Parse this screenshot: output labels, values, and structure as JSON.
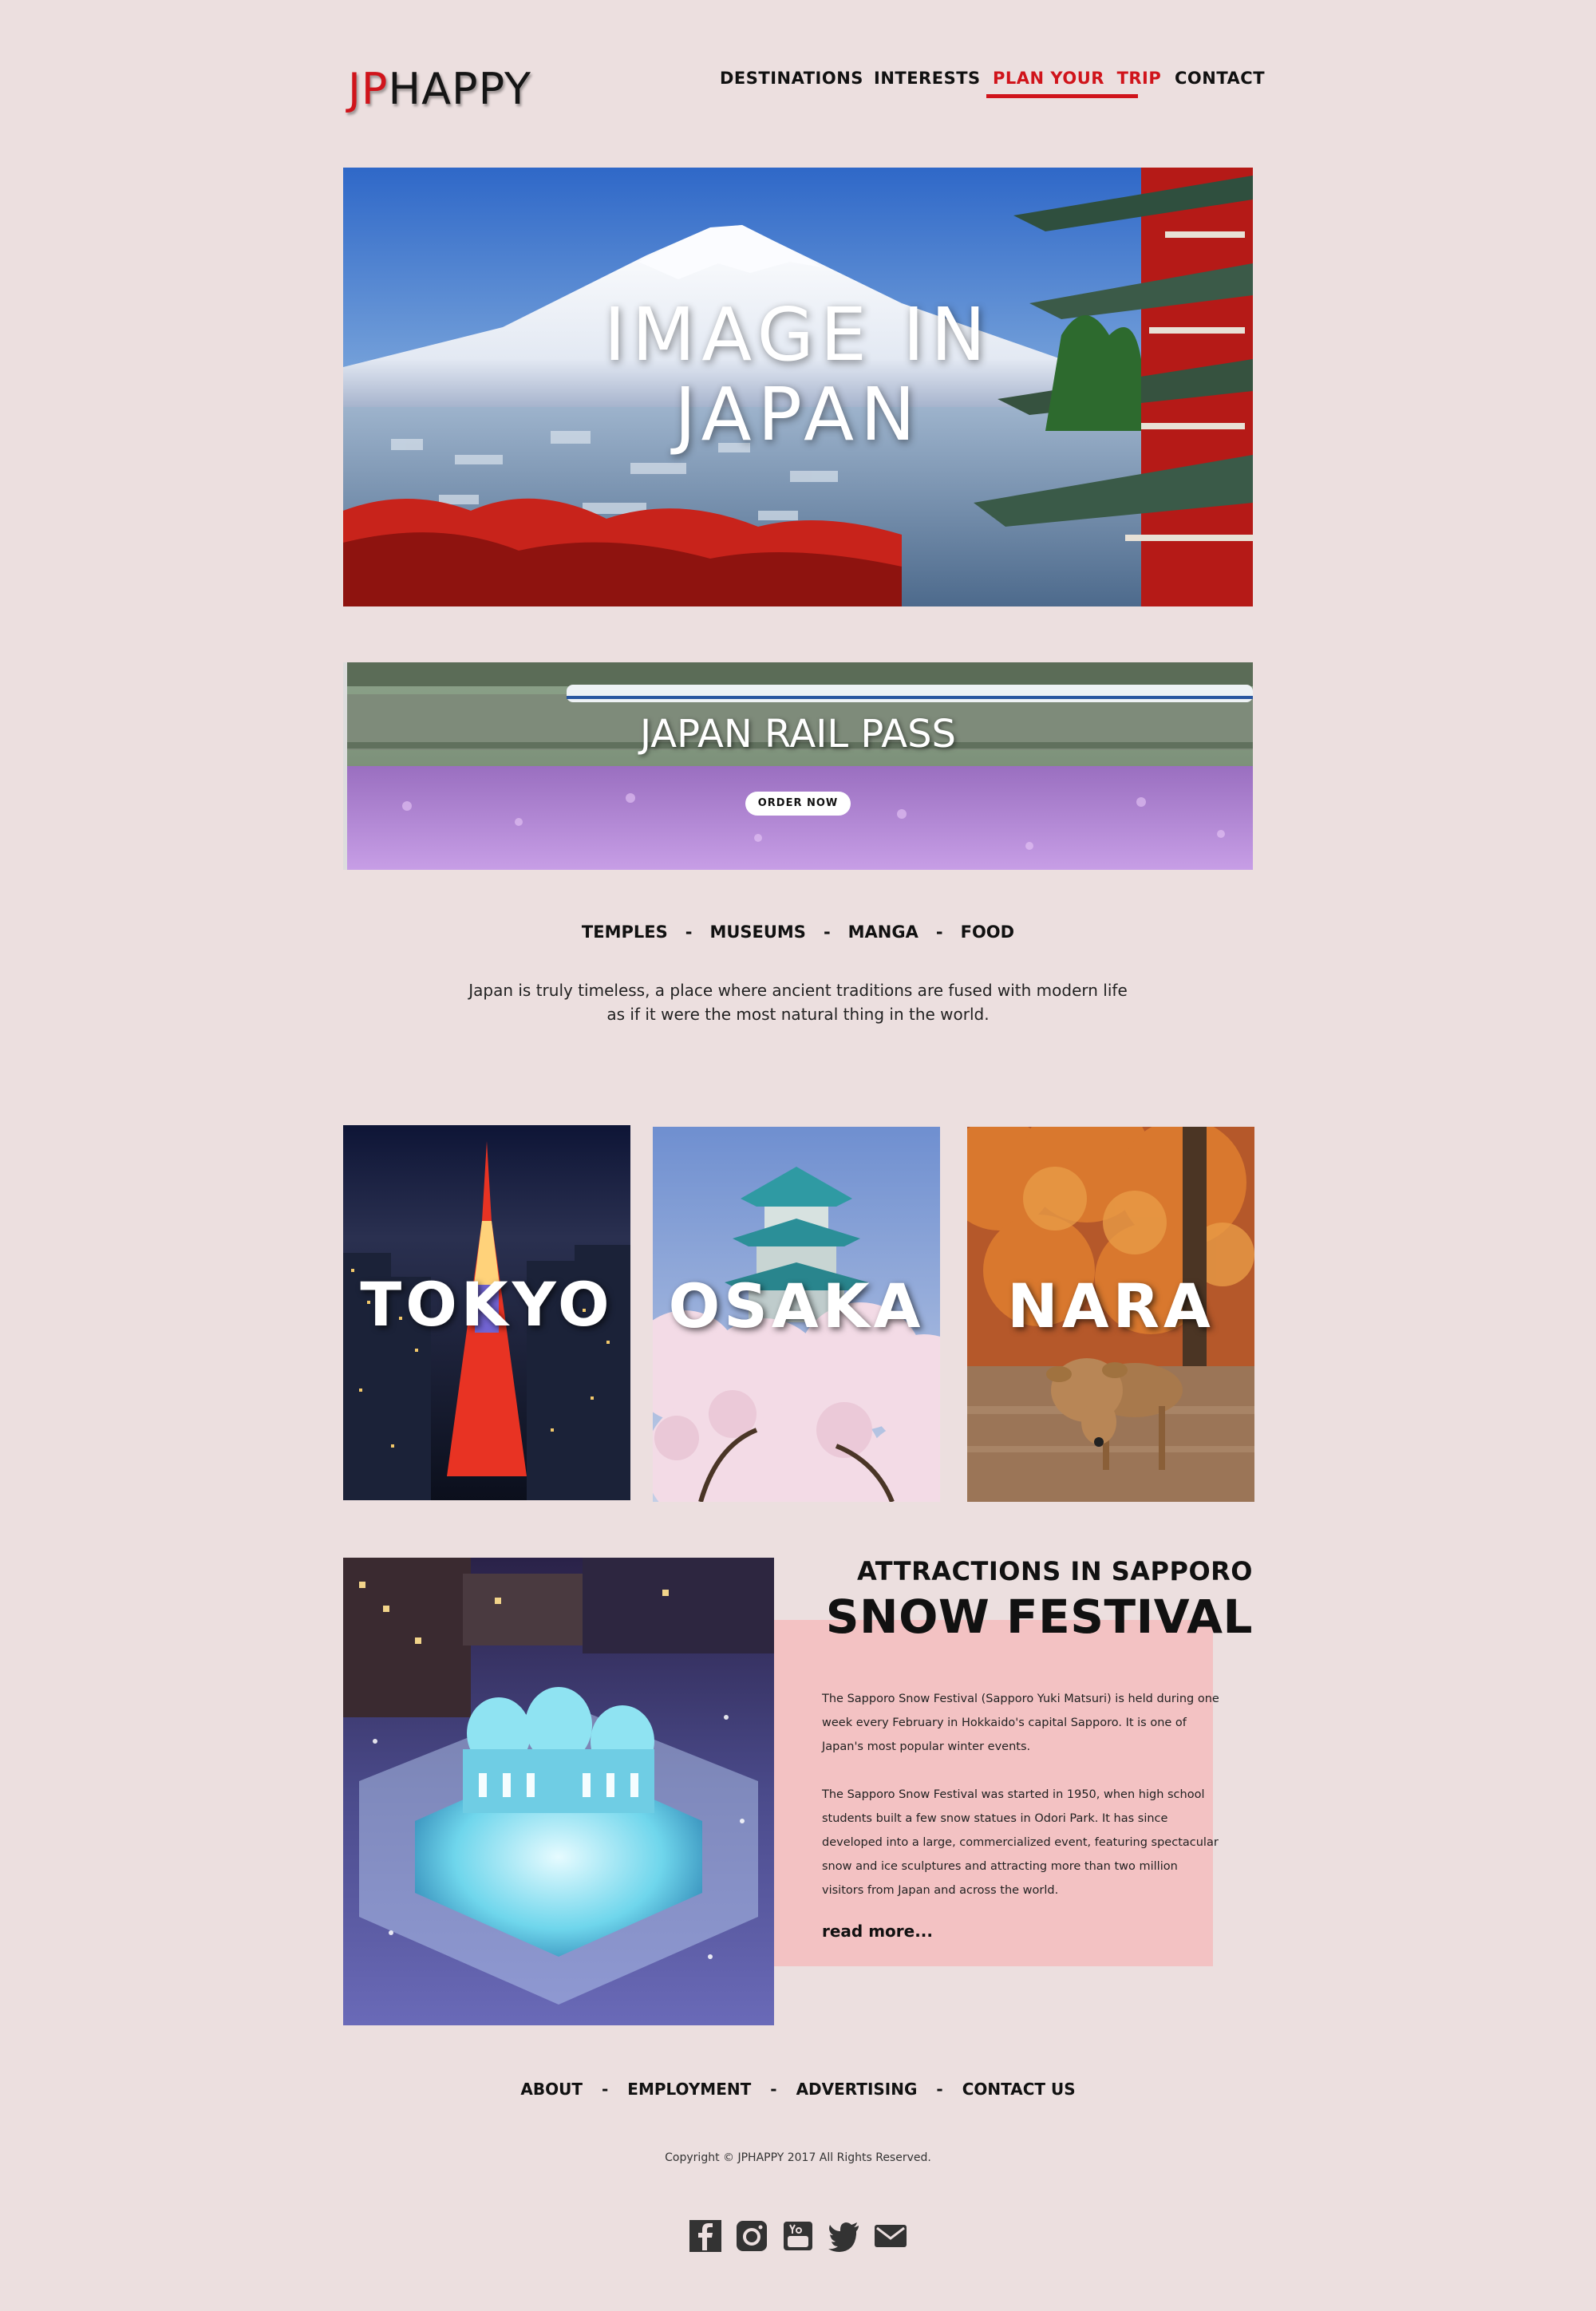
{
  "header": {
    "logo_jp": "JP",
    "logo_happy": "HAPPY",
    "nav": [
      {
        "label": "DESTINATIONS"
      },
      {
        "label": "INTERESTS"
      },
      {
        "label": "PLAN YOUR  TRIP",
        "active": true
      },
      {
        "label": "CONTACT"
      }
    ]
  },
  "hero": {
    "title_line1": "IMAGE IN",
    "title_line2": "JAPAN"
  },
  "rail": {
    "title": "JAPAN RAIL PASS",
    "button": "ORDER NOW"
  },
  "interests": {
    "items": [
      "TEMPLES",
      "MUSEUMS",
      "MANGA",
      "FOOD"
    ],
    "separator": "-"
  },
  "intro": "Japan is truly timeless, a place where ancient traditions are fused with modern life as if it were the most natural thing in the world.",
  "cities": [
    {
      "name": "TOKYO"
    },
    {
      "name": "OSAKA"
    },
    {
      "name": "NARA"
    }
  ],
  "sapporo": {
    "subtitle": "ATTRACTIONS IN SAPPORO",
    "title": "SNOW FESTIVAL",
    "para1": "The Sapporo Snow Festival (Sapporo Yuki Matsuri) is held during one week every February in Hokkaido's capital Sapporo. It is one of Japan's most popular winter events.",
    "para2": "The Sapporo Snow Festival was started in 1950, when high school students built a few snow statues in Odori Park. It has since developed into a large, commercialized event, featuring spectacular snow and ice sculptures and attracting more than two million visitors from Japan and across the world.",
    "read_more": "read more..."
  },
  "footer": {
    "links": [
      "ABOUT",
      "EMPLOYMENT",
      "ADVERTISING",
      "CONTACT US"
    ],
    "separator": "-",
    "copyright": "Copyright © JPHAPPY 2017 All Rights Reserved.",
    "social": [
      "facebook-icon",
      "instagram-icon",
      "youtube-icon",
      "twitter-icon",
      "mail-icon"
    ]
  },
  "colors": {
    "background": "#ecdfdf",
    "accent": "#d0141b",
    "pink_box": "#f3c2c3"
  }
}
